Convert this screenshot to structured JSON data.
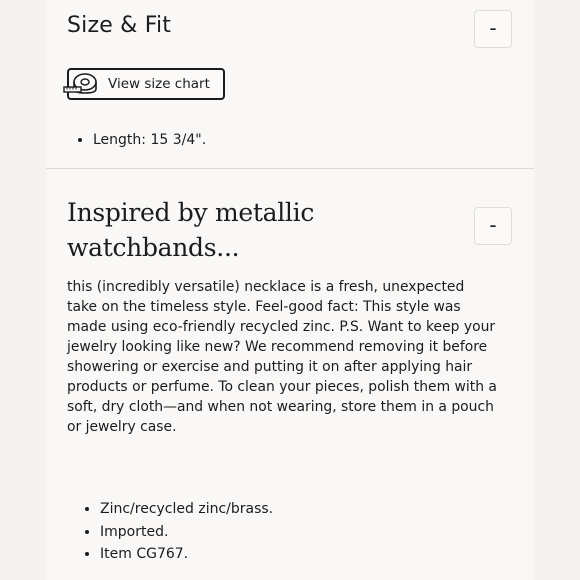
{
  "size_fit": {
    "title": "Size & Fit",
    "toggle_label": "-",
    "size_chart_button": {
      "label": "View size chart",
      "icon": "measuring-tape-icon"
    },
    "details": [
      "Length: 15 3/4\"."
    ]
  },
  "description_section": {
    "title": "Inspired by metallic watchbands...",
    "toggle_label": "-",
    "body": "this (incredibly versatile) necklace is a fresh, unexpected take on the timeless style. Feel-good fact: This style was made using eco-friendly recycled zinc. P.S. Want to keep your jewelry looking like new? We recommend removing it before showering or exercise and putting it on after applying hair products or perfume. To clean your pieces, polish them with a soft, dry cloth—and when not wearing, store them in a pouch or jewelry case.",
    "details": [
      "Zinc/recycled zinc/brass.",
      "Imported.",
      "Item CG767."
    ]
  }
}
